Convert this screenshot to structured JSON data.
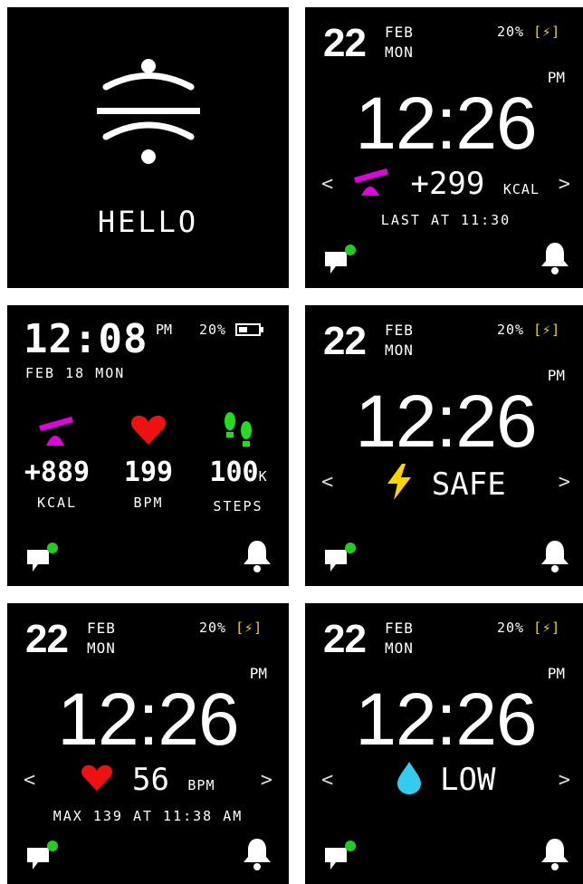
{
  "colors": {
    "background": "#000000",
    "text": "#ffffff",
    "accent_magenta": "#e000e0",
    "heart_red": "#ee1111",
    "steps_green": "#22dd22",
    "bolt_yellow": "#ffd400",
    "water_cyan": "#33ccee",
    "notif_green": "#22cc22"
  },
  "screen1": {
    "greeting": "HELLO",
    "icon": "logo-icon"
  },
  "screen2": {
    "day": "22",
    "month": "FEB",
    "weekday": "MON",
    "battery": "20%",
    "ampm": "PM",
    "time": "12:26",
    "metric_value": "+299",
    "metric_unit": "KCAL",
    "sub": "LAST AT 11:30",
    "icon": "scale-icon"
  },
  "screen3": {
    "time": "12:08",
    "ampm": "PM",
    "battery": "20%",
    "date": "FEB 18 MON",
    "stats": [
      {
        "value": "+889",
        "unit": "",
        "label": "KCAL",
        "icon": "scale-icon"
      },
      {
        "value": "199",
        "unit": "",
        "label": "BPM",
        "icon": "heart-icon"
      },
      {
        "value": "100",
        "unit": "K",
        "label": "STEPS",
        "icon": "footsteps-icon"
      }
    ]
  },
  "screen4": {
    "day": "22",
    "month": "FEB",
    "weekday": "MON",
    "battery": "20%",
    "ampm": "PM",
    "time": "12:26",
    "status": "SAFE",
    "icon": "lightning-icon"
  },
  "screen5": {
    "day": "22",
    "month": "FEB",
    "weekday": "MON",
    "battery": "20%",
    "ampm": "PM",
    "time": "12:26",
    "metric_value": "56",
    "metric_unit": "BPM",
    "sub": "MAX 139 AT 11:38 AM",
    "icon": "heart-icon"
  },
  "screen6": {
    "day": "22",
    "month": "FEB",
    "weekday": "MON",
    "battery": "20%",
    "ampm": "PM",
    "time": "12:26",
    "status": "LOW",
    "icon": "water-drop-icon"
  },
  "nav": {
    "prev": "<",
    "next": ">"
  },
  "footer": {
    "left_icon": "message-icon",
    "right_icon": "bell-icon"
  }
}
